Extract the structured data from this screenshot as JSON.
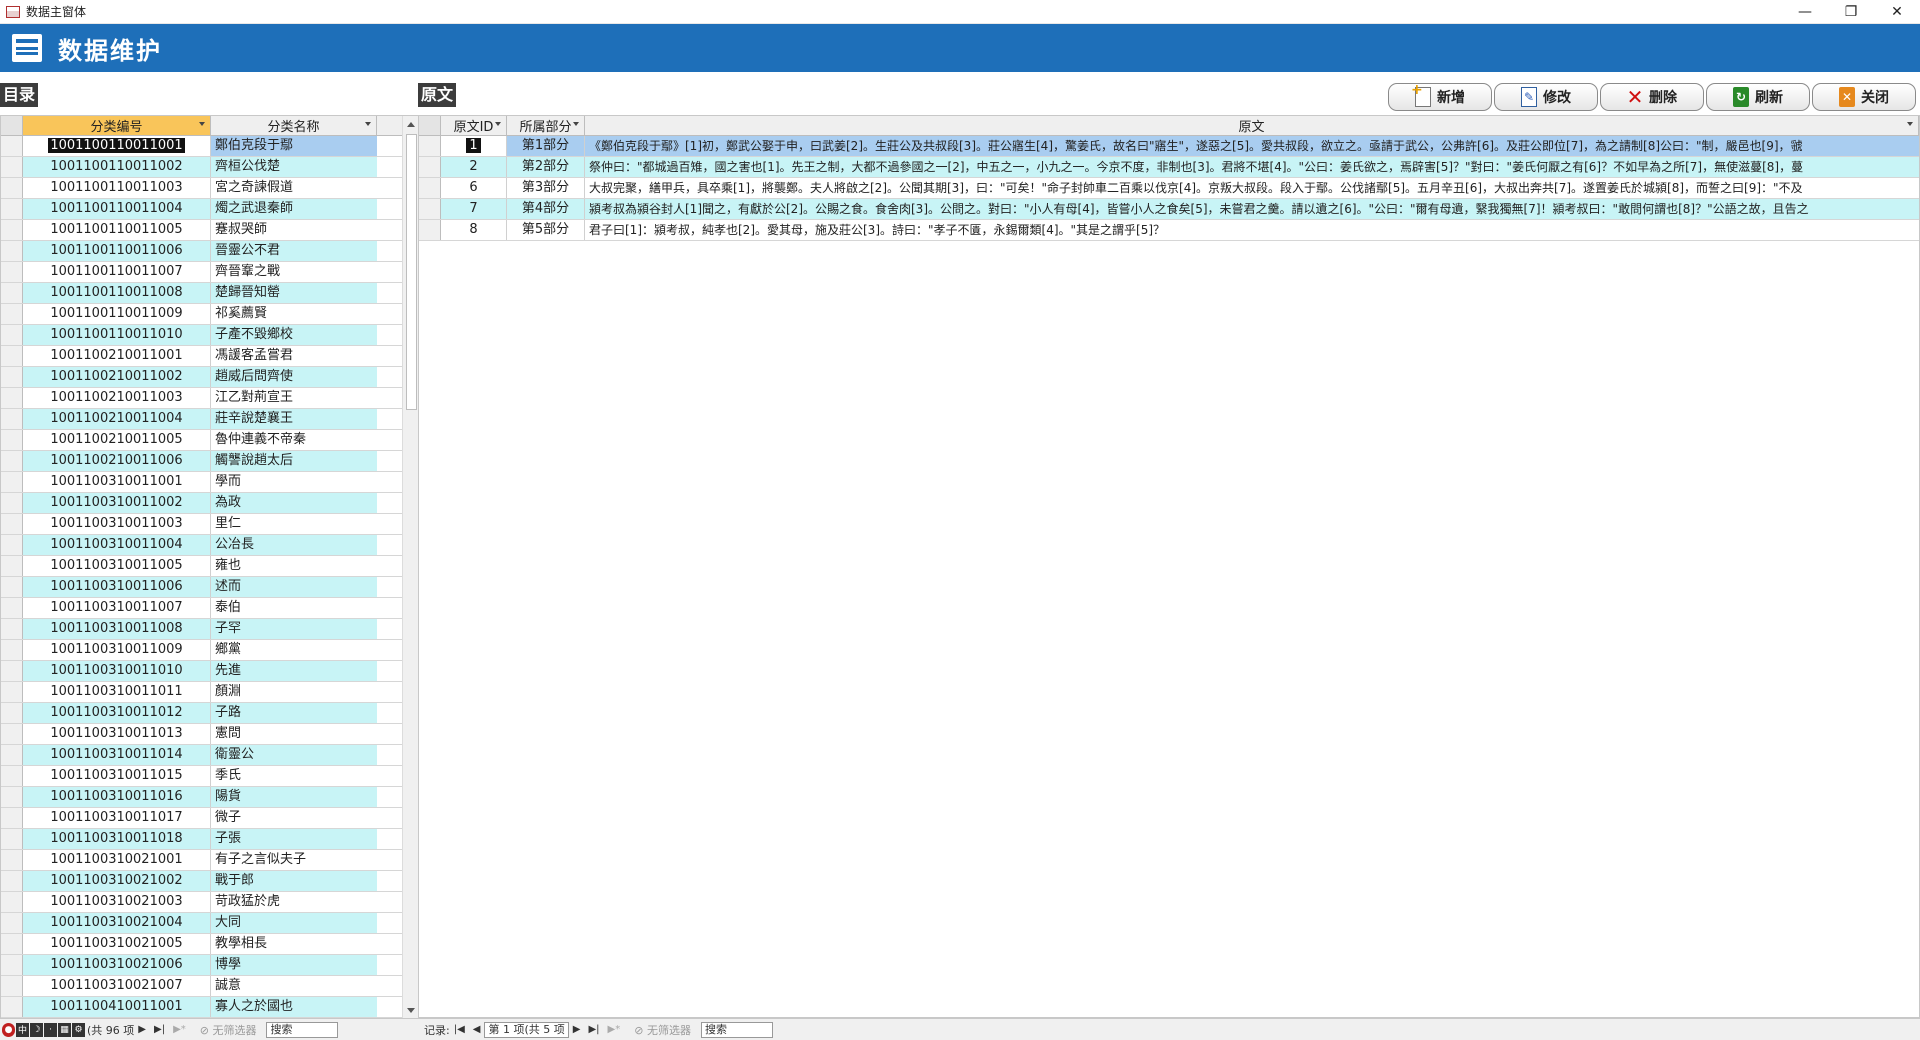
{
  "window": {
    "title": "数据主窗体",
    "controls": [
      "—",
      "❐",
      "✕"
    ]
  },
  "header": {
    "title": "数据维护"
  },
  "left": {
    "label": "目录",
    "columns": [
      "分类编号",
      "分类名称"
    ],
    "rows": [
      {
        "id": "1001100110011001",
        "name": "鄭伯克段于鄢"
      },
      {
        "id": "1001100110011002",
        "name": "齊桓公伐楚"
      },
      {
        "id": "1001100110011003",
        "name": "宮之奇諫假道"
      },
      {
        "id": "1001100110011004",
        "name": "燭之武退秦師"
      },
      {
        "id": "1001100110011005",
        "name": "蹇叔哭師"
      },
      {
        "id": "1001100110011006",
        "name": "晉靈公不君"
      },
      {
        "id": "1001100110011007",
        "name": "齊晉鞌之戰"
      },
      {
        "id": "1001100110011008",
        "name": "楚歸晉知罃"
      },
      {
        "id": "1001100110011009",
        "name": "祁奚薦賢"
      },
      {
        "id": "1001100110011010",
        "name": "子產不毀鄉校"
      },
      {
        "id": "1001100210011001",
        "name": "馮諼客孟嘗君"
      },
      {
        "id": "1001100210011002",
        "name": "趙威后問齊使"
      },
      {
        "id": "1001100210011003",
        "name": "江乙對荊宣王"
      },
      {
        "id": "1001100210011004",
        "name": "莊辛說楚襄王"
      },
      {
        "id": "1001100210011005",
        "name": "魯仲連義不帝秦"
      },
      {
        "id": "1001100210011006",
        "name": "觸讋說趙太后"
      },
      {
        "id": "1001100310011001",
        "name": "學而"
      },
      {
        "id": "1001100310011002",
        "name": "為政"
      },
      {
        "id": "1001100310011003",
        "name": "里仁"
      },
      {
        "id": "1001100310011004",
        "name": "公冶長"
      },
      {
        "id": "1001100310011005",
        "name": "雍也"
      },
      {
        "id": "1001100310011006",
        "name": "述而"
      },
      {
        "id": "1001100310011007",
        "name": "泰伯"
      },
      {
        "id": "1001100310011008",
        "name": "子罕"
      },
      {
        "id": "1001100310011009",
        "name": "鄉黨"
      },
      {
        "id": "1001100310011010",
        "name": "先進"
      },
      {
        "id": "1001100310011011",
        "name": "顏淵"
      },
      {
        "id": "1001100310011012",
        "name": "子路"
      },
      {
        "id": "1001100310011013",
        "name": "憲問"
      },
      {
        "id": "1001100310011014",
        "name": "衛靈公"
      },
      {
        "id": "1001100310011015",
        "name": "季氏"
      },
      {
        "id": "1001100310011016",
        "name": "陽貨"
      },
      {
        "id": "1001100310011017",
        "name": "微子"
      },
      {
        "id": "1001100310011018",
        "name": "子張"
      },
      {
        "id": "1001100310021001",
        "name": "有子之言似夫子"
      },
      {
        "id": "1001100310021002",
        "name": "戰于郎"
      },
      {
        "id": "1001100310021003",
        "name": "苛政猛於虎"
      },
      {
        "id": "1001100310021004",
        "name": "大同"
      },
      {
        "id": "1001100310021005",
        "name": "教學相長"
      },
      {
        "id": "1001100310021006",
        "name": "博學"
      },
      {
        "id": "1001100310021007",
        "name": "誠意"
      },
      {
        "id": "1001100410011001",
        "name": "寡人之於國也"
      }
    ],
    "nav": {
      "record_text": "(共 96 项",
      "filter": "无筛选器",
      "search": "搜索"
    }
  },
  "right": {
    "label": "原文",
    "columns": [
      "原文ID",
      "所属部分",
      "原文"
    ],
    "rows": [
      {
        "id": "1",
        "part": "第1部分",
        "text": "《鄭伯克段于鄢》[1]初，鄭武公娶于申，曰武姜[2]。生莊公及共叔段[3]。莊公寤生[4]，驚姜氏，故名曰\"寤生\"，遂惡之[5]。愛共叔段，欲立之。亟請于武公，公弗許[6]。及莊公即位[7]，為之請制[8]公曰：\"制，嚴邑也[9]，虢"
      },
      {
        "id": "2",
        "part": "第2部分",
        "text": "祭仲曰：\"都城過百雉，國之害也[1]。先王之制，大都不過參國之一[2]，中五之一，小九之一。今京不度，非制也[3]。君將不堪[4]。\"公曰：姜氏欲之，焉辟害[5]？\"對曰：\"姜氏何厭之有[6]？不如早為之所[7]，無使滋蔓[8]，蔓"
      },
      {
        "id": "6",
        "part": "第3部分",
        "text": "大叔完聚，繕甲兵，具卒乘[1]，將襲鄭。夫人將啟之[2]。公聞其期[3]，曰：\"可矣！\"命子封帥車二百乘以伐京[4]。京叛大叔段。段入于鄢。公伐諸鄢[5]。五月辛丑[6]，大叔出奔共[7]。遂置姜氏於城潁[8]，而誓之曰[9]：\"不及"
      },
      {
        "id": "7",
        "part": "第4部分",
        "text": "潁考叔為潁谷封人[1]聞之，有獻於公[2]。公賜之食。食舍肉[3]。公問之。對曰：\"小人有母[4]，皆嘗小人之食矣[5]，未嘗君之羹。請以遺之[6]。\"公曰：\"爾有母遺，繄我獨無[7]！潁考叔曰：\"敢問何謂也[8]？\"公語之故，且告之"
      },
      {
        "id": "8",
        "part": "第5部分",
        "text": "君子曰[1]：潁考叔，純孝也[2]。愛其母，施及莊公[3]。詩曰：\"孝子不匱，永錫爾類[4]。\"其是之謂乎[5]？"
      }
    ],
    "nav": {
      "label": "记录:",
      "record_text": "第 1 项(共 5 项",
      "filter": "无筛选器",
      "search": "搜索"
    }
  },
  "toolbar": {
    "new": "新增",
    "edit": "修改",
    "delete": "删除",
    "refresh": "刷新",
    "close": "关闭"
  }
}
